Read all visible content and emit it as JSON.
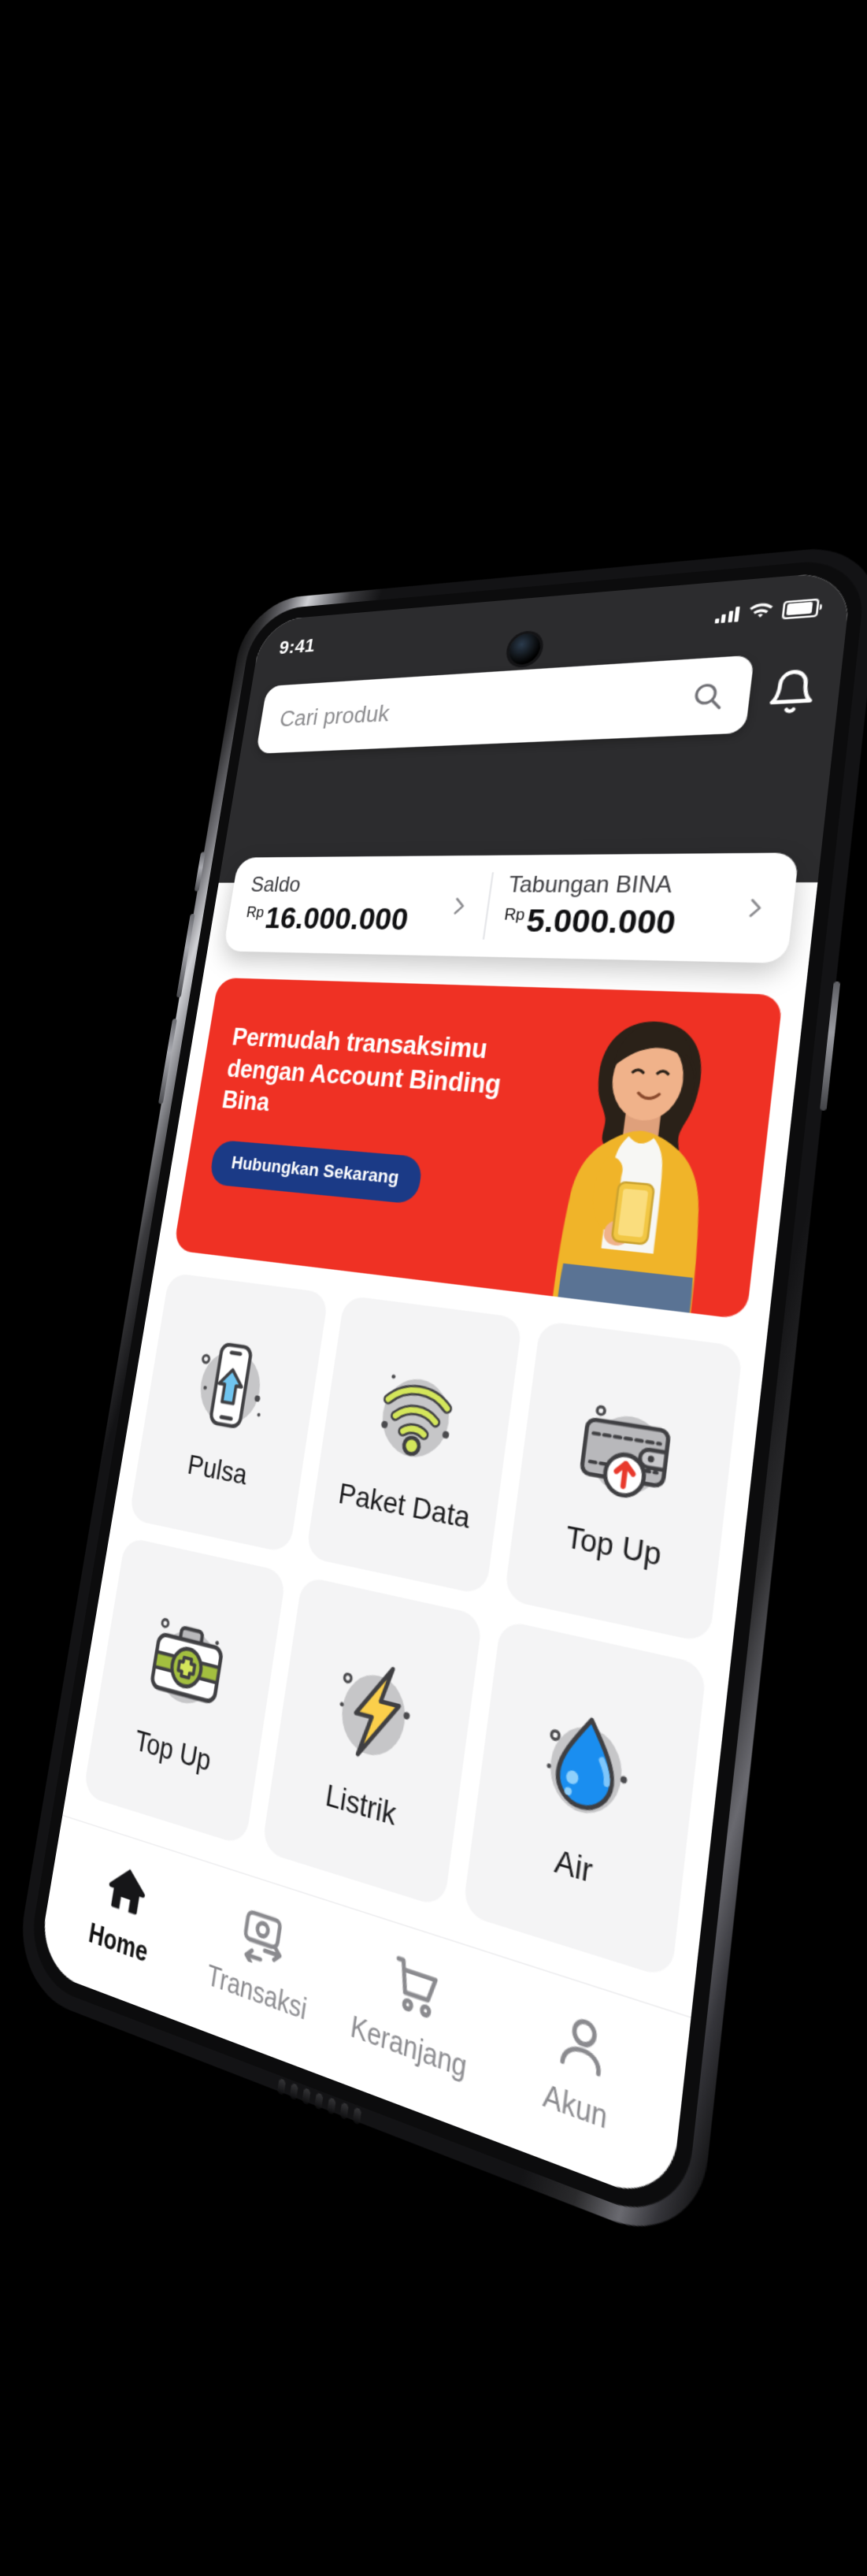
{
  "status_bar": {
    "time": "9:41",
    "signal_icon": "signal-bars-icon",
    "wifi_icon": "wifi-icon",
    "battery_icon": "battery-icon"
  },
  "search": {
    "placeholder": "Cari produk",
    "search_icon": "search-icon",
    "notification_icon": "bell-icon"
  },
  "balance": {
    "accounts": [
      {
        "label": "Saldo",
        "currency": "Rp",
        "amount": "16.000.000",
        "chevron_icon": "chevron-right-icon"
      },
      {
        "label": "Tabungan BINA",
        "currency": "Rp",
        "amount": "5.000.000",
        "chevron_icon": "chevron-right-icon"
      }
    ]
  },
  "promo": {
    "line1": "Permudah transaksimu",
    "line2": "dengan Account Binding Bina",
    "cta_label": "Hubungkan Sekarang",
    "background_color": "#ef3124",
    "cta_color": "#1b3a86",
    "image_alt": "woman-holding-phone-photo"
  },
  "services": [
    {
      "label": "Pulsa",
      "icon": "phone-topup-icon",
      "accent": "#4db6f0"
    },
    {
      "label": "Paket Data",
      "icon": "wifi-signal-icon",
      "accent": "#d4e65b"
    },
    {
      "label": "Top Up",
      "icon": "wallet-topup-icon",
      "accent": "#e8392c"
    },
    {
      "label": "Top Up",
      "icon": "medical-kit-icon",
      "accent": "#a3bf3f"
    },
    {
      "label": "Listrik",
      "icon": "lightning-bolt-icon",
      "accent": "#fbcf4b"
    },
    {
      "label": "Air",
      "icon": "water-drop-icon",
      "accent": "#1a8ef0"
    }
  ],
  "tabbar": {
    "items": [
      {
        "label": "Home",
        "icon": "home-icon",
        "active": true
      },
      {
        "label": "Transaksi",
        "icon": "transaction-icon",
        "active": false
      },
      {
        "label": "Keranjang",
        "icon": "cart-icon",
        "active": false
      },
      {
        "label": "Akun",
        "icon": "user-icon",
        "active": false
      }
    ]
  },
  "colors": {
    "brand_red": "#ef3124",
    "brand_blue": "#1b3a86",
    "header_dark": "#2c2c2e",
    "tile_bg": "#f4f4f5"
  }
}
